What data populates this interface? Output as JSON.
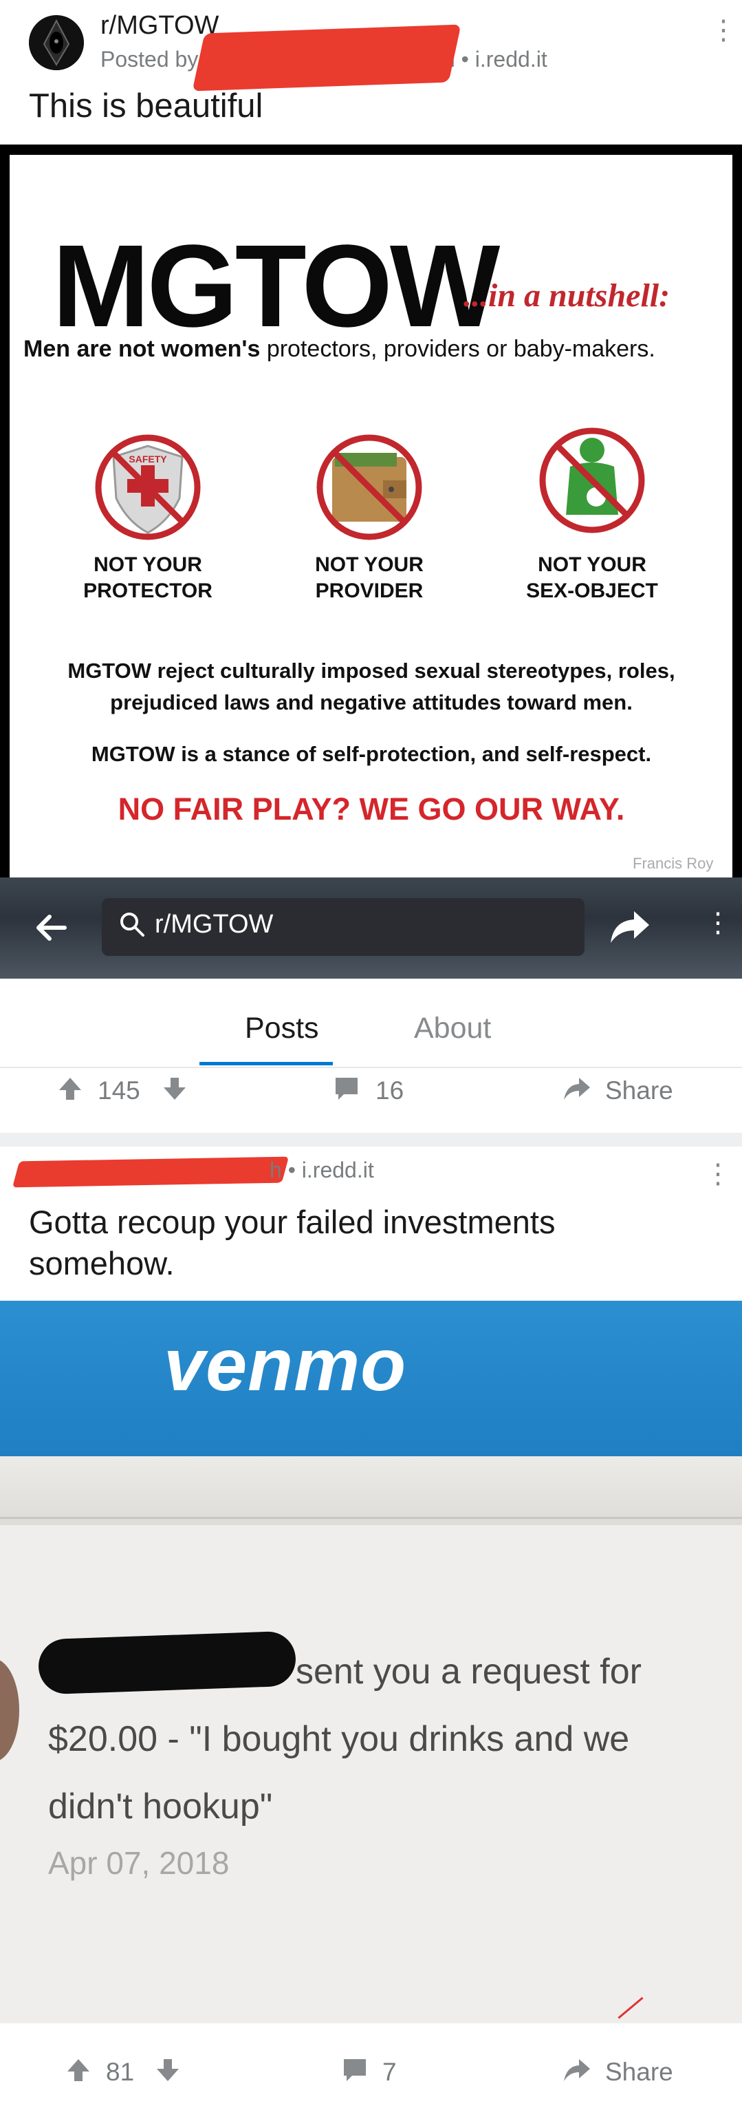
{
  "post1": {
    "subreddit": "r/MGTOW",
    "meta": "Posted by",
    "meta_tail": "• 9h • i.redd.it",
    "title": "This is beautiful",
    "upvotes": "145",
    "comments": "16",
    "share": "Share"
  },
  "poster": {
    "headline": "MGTOW",
    "subhead": "...in a nutshell:",
    "tagline_bold": "Men are not women's",
    "tagline_rest": "protectors, providers or baby-makers.",
    "icons": [
      {
        "label1": "NOT YOUR",
        "label2": "PROTECTOR"
      },
      {
        "label1": "NOT YOUR",
        "label2": "PROVIDER"
      },
      {
        "label1": "NOT YOUR",
        "label2": "SEX-OBJECT"
      }
    ],
    "para1": "MGTOW reject culturally imposed sexual stereotypes, roles, prejudiced laws and negative attitudes toward men.",
    "para2": "MGTOW is a stance of self-protection, and self-respect.",
    "slogan": "NO FAIR PLAY? WE GO OUR WAY.",
    "credit": "Francis Roy",
    "shield_text": "SAFETY"
  },
  "topbar": {
    "search_value": "r/MGTOW"
  },
  "tabs": {
    "posts": "Posts",
    "about": "About"
  },
  "post2": {
    "meta": "h • i.redd.it",
    "title": "Gotta recoup your failed investments somehow.",
    "upvotes": "81",
    "comments": "7",
    "share": "Share"
  },
  "venmo": {
    "logo": "venmo",
    "request_line1": "sent you a request for",
    "request_line2": "$20.00 - \"I bought you drinks and we",
    "request_line3": "didn't hookup\"",
    "date": "Apr 07, 2018"
  },
  "colors": {
    "accent": "#0079d3",
    "redact": "#ea3b2f",
    "meta": "#787c7e",
    "slogan": "#d4262b",
    "venmo_blue": "#2b8fd0"
  }
}
